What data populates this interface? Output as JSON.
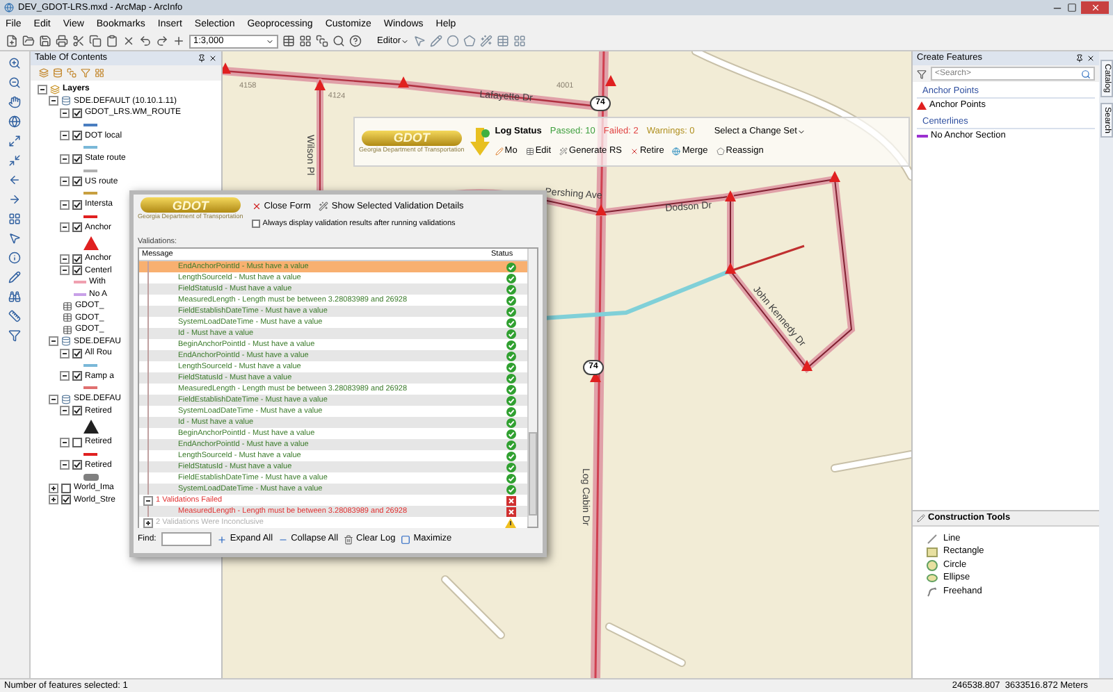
{
  "window": {
    "title": "DEV_GDOT-LRS.mxd - ArcMap - ArcInfo"
  },
  "menu": [
    "File",
    "Edit",
    "View",
    "Bookmarks",
    "Insert",
    "Selection",
    "Geoprocessing",
    "Customize",
    "Windows",
    "Help"
  ],
  "toolbar": {
    "scale": "1:3,000",
    "editor": "Editor"
  },
  "toc": {
    "title": "Table Of Contents",
    "tree": [
      {
        "kind": "root",
        "label": "Layers",
        "expanded": true,
        "children": [
          {
            "kind": "database",
            "label": "SDE.DEFAULT (10.10.1.11)",
            "expanded": true,
            "children": [
              {
                "kind": "layer",
                "label": "GDOT_LRS.WM_ROUTE",
                "checked": true,
                "expanded": true,
                "symbol": {
                  "kind": "line",
                  "color": "#4a7ec0"
                }
              },
              {
                "kind": "layer",
                "label": "DOT local",
                "checked": true,
                "expanded": true,
                "symbol": {
                  "kind": "line",
                  "color": "#7ab8d8"
                }
              },
              {
                "kind": "layer",
                "label": "State route",
                "checked": true,
                "expanded": true,
                "symbol": {
                  "kind": "line",
                  "color": "#b0b0b0"
                }
              },
              {
                "kind": "layer",
                "label": "US route",
                "checked": true,
                "expanded": true,
                "symbol": {
                  "kind": "line",
                  "color": "#c8a040"
                }
              },
              {
                "kind": "layer",
                "label": "Intersta",
                "checked": true,
                "expanded": true,
                "symbol": {
                  "kind": "line",
                  "color": "#e02020"
                }
              },
              {
                "kind": "layer",
                "label": "Anchor",
                "checked": true,
                "expanded": true,
                "symbol": {
                  "kind": "triangle",
                  "color": "#e02020"
                }
              },
              {
                "kind": "layer",
                "label": "Anchor",
                "checked": true,
                "expanded": true
              },
              {
                "kind": "layer",
                "label": "Centerl",
                "checked": true,
                "expanded": true,
                "children": [
                  {
                    "kind": "legend",
                    "label": "With",
                    "color": "#f0a0b0"
                  },
                  {
                    "kind": "legend",
                    "label": "No A",
                    "color": "#c8a0e8"
                  }
                ]
              },
              {
                "kind": "table",
                "label": "GDOT_"
              },
              {
                "kind": "table",
                "label": "GDOT_"
              },
              {
                "kind": "table",
                "label": "GDOT_"
              }
            ]
          },
          {
            "kind": "database",
            "label": "SDE.DEFAU",
            "expanded": true,
            "children": [
              {
                "kind": "layer",
                "label": "All Rou",
                "checked": true,
                "expanded": true,
                "symbol": {
                  "kind": "line",
                  "color": "#7ab8d8"
                }
              },
              {
                "kind": "layer",
                "label": "Ramp a",
                "checked": true,
                "expanded": true,
                "symbol": {
                  "kind": "line",
                  "color": "#e07070"
                }
              }
            ]
          },
          {
            "kind": "database",
            "label": "SDE.DEFAU",
            "expanded": true,
            "children": [
              {
                "kind": "layer",
                "label": "Retired",
                "checked": true,
                "expanded": true,
                "symbol": {
                  "kind": "triangle",
                  "color": "#202020"
                }
              },
              {
                "kind": "layer",
                "label": "Retired",
                "checked": false,
                "expanded": true,
                "symbol": {
                  "kind": "line",
                  "color": "#e02020"
                }
              },
              {
                "kind": "layer",
                "label": "Retired",
                "checked": true,
                "expanded": true,
                "symbol": {
                  "kind": "pill",
                  "color": "#808080"
                }
              }
            ]
          },
          {
            "kind": "layer",
            "label": "World_Ima",
            "checked": false,
            "expanded": false
          },
          {
            "kind": "layer",
            "label": "World_Stre",
            "checked": true,
            "expanded": false
          }
        ]
      }
    ]
  },
  "map": {
    "labels": [
      {
        "text": "4158",
        "kind": "number"
      },
      {
        "text": "4124",
        "kind": "number"
      },
      {
        "text": "4001",
        "kind": "number"
      },
      {
        "text": "Lafayette Dr",
        "kind": "street"
      },
      {
        "text": "74",
        "kind": "shield"
      },
      {
        "text": "Wilson Pl",
        "kind": "street"
      },
      {
        "text": "Pershing Ave",
        "kind": "street"
      },
      {
        "text": "Dodson Dr",
        "kind": "street"
      },
      {
        "text": "John Kennedy Dr",
        "kind": "street"
      },
      {
        "text": "74",
        "kind": "shield"
      },
      {
        "text": "Log Cabin Dr",
        "kind": "street"
      }
    ]
  },
  "lrs_toolbar": {
    "logo": {
      "name": "GDOT",
      "tagline": "Georgia Department of Transportation"
    },
    "log_status": "Log Status",
    "counts": [
      {
        "text": "Passed: 10",
        "kind": "passed"
      },
      {
        "text": "Failed: 2",
        "kind": "failed"
      },
      {
        "text": "Warnings: 0",
        "kind": "warning"
      }
    ],
    "change_set": "Select a Change Set",
    "actions": [
      "Mo",
      "Edit",
      "Generate RS",
      "Retire",
      "Merge",
      "Reassign"
    ]
  },
  "validation_dialog": {
    "logo": {
      "name": "GDOT",
      "tagline": "Georgia Department of Transportation"
    },
    "buttons": [
      "Close Form",
      "Show Selected Validation Details"
    ],
    "always_display": {
      "label": "Always display validation results after running validations",
      "checked": false
    },
    "list_label": "Validations:",
    "columns": [
      "Message",
      "Status"
    ],
    "rows": [
      {
        "kind": "passed_item",
        "text": "EndAnchorPointId - Must have a value",
        "selected": true
      },
      {
        "kind": "passed_item",
        "text": "LengthSourceId - Must have a value",
        "selected": false
      },
      {
        "kind": "passed_item",
        "text": "FieldStatusId - Must have a value",
        "selected": false
      },
      {
        "kind": "passed_item",
        "text": "MeasuredLength - Length must be between 3.28083989 and 26928",
        "selected": false
      },
      {
        "kind": "passed_item",
        "text": "FieldEstablishDateTime - Must have a value",
        "selected": false
      },
      {
        "kind": "passed_item",
        "text": "SystemLoadDateTime - Must have a value",
        "selected": false
      },
      {
        "kind": "passed_item",
        "text": "Id - Must have a value",
        "selected": false
      },
      {
        "kind": "passed_item",
        "text": "BeginAnchorPointId - Must have a value",
        "selected": false
      },
      {
        "kind": "passed_item",
        "text": "EndAnchorPointId - Must have a value",
        "selected": false
      },
      {
        "kind": "passed_item",
        "text": "LengthSourceId - Must have a value",
        "selected": false
      },
      {
        "kind": "passed_item",
        "text": "FieldStatusId - Must have a value",
        "selected": false
      },
      {
        "kind": "passed_item",
        "text": "MeasuredLength - Length must be between 3.28083989 and 26928",
        "selected": false
      },
      {
        "kind": "passed_item",
        "text": "FieldEstablishDateTime - Must have a value",
        "selected": false
      },
      {
        "kind": "passed_item",
        "text": "SystemLoadDateTime - Must have a value",
        "selected": false
      },
      {
        "kind": "passed_item",
        "text": "Id - Must have a value",
        "selected": false
      },
      {
        "kind": "passed_item",
        "text": "BeginAnchorPointId - Must have a value",
        "selected": false
      },
      {
        "kind": "passed_item",
        "text": "EndAnchorPointId - Must have a value",
        "selected": false
      },
      {
        "kind": "passed_item",
        "text": "LengthSourceId - Must have a value",
        "selected": false
      },
      {
        "kind": "passed_item",
        "text": "FieldStatusId - Must have a value",
        "selected": false
      },
      {
        "kind": "passed_item",
        "text": "FieldEstablishDateTime - Must have a value",
        "selected": false
      },
      {
        "kind": "passed_item",
        "text": "SystemLoadDateTime - Must have a value",
        "selected": false
      },
      {
        "kind": "failed_group",
        "text": "1 Validations Failed",
        "expanded": true,
        "selected": false
      },
      {
        "kind": "failed_item",
        "text": "MeasuredLength - Length must be between 3.28083989 and 26928",
        "selected": false
      },
      {
        "kind": "warning_group",
        "text": "2 Validations Were Inconclusive",
        "expanded": false,
        "selected": false
      }
    ],
    "find_label": "Find:",
    "footer_buttons": [
      "Expand All",
      "Collapse All",
      "Clear Log",
      "Maximize"
    ]
  },
  "create_features": {
    "title": "Create Features",
    "search_placeholder": "<Search>",
    "groups": [
      {
        "label": "Anchor Points",
        "items": [
          {
            "label": "Anchor Points",
            "kind": "triangle",
            "color": "#e02020"
          }
        ]
      },
      {
        "label": "Centerlines",
        "items": [
          {
            "label": "No Anchor Section",
            "kind": "line",
            "color": "#9b30d0"
          }
        ]
      }
    ]
  },
  "construction_tools": {
    "title": "Construction Tools",
    "tools": [
      "Line",
      "Rectangle",
      "Circle",
      "Ellipse",
      "Freehand"
    ]
  },
  "side_tabs": [
    "Catalog",
    "Search"
  ],
  "status_bar": {
    "selection": "Number of features selected: 1",
    "coordinates": "246538.807  3633516.872 Meters"
  }
}
